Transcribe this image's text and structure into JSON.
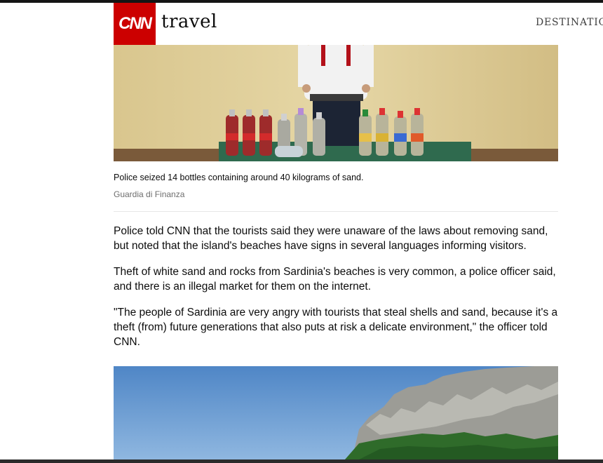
{
  "header": {
    "logo_text": "CNN",
    "section": "travel",
    "nav_item": "DESTINATIONS"
  },
  "article": {
    "caption": "Police seized 14 bottles containing around 40 kilograms of sand.",
    "credit": "Guardia di Finanza",
    "paragraphs": [
      "Police told CNN that the tourists said they were unaware of the laws about removing sand, but noted that the island's beaches have signs in several languages informing visitors.",
      "Theft of white sand and rocks from Sardinia's beaches is very common, a police officer said, and there is an illegal market for them on the internet.",
      "\"The people of Sardinia are very angry with tourists that steal shells and sand, because it's a theft (from) future generations that also puts at risk a delicate environment,\" the officer told CNN."
    ]
  },
  "colors": {
    "brand_red": "#cc0000",
    "text": "#0c0c0c",
    "muted": "#6e6e6e"
  }
}
